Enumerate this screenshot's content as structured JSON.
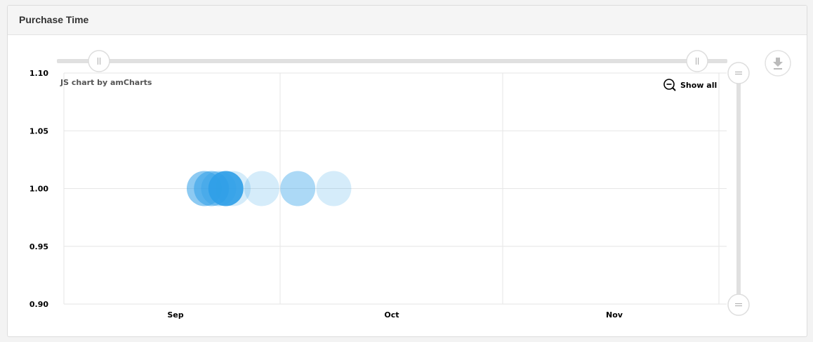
{
  "panel": {
    "title": "Purchase Time"
  },
  "chart_data": {
    "type": "scatter",
    "title": "",
    "xlabel": "",
    "ylabel": "",
    "x_ticks": [
      "Sep",
      "Oct",
      "Nov"
    ],
    "y_ticks": [
      "1.10",
      "1.05",
      "1.00",
      "0.95",
      "0.90"
    ],
    "ylim": [
      0.9,
      1.1
    ],
    "xlim": [
      "2017-08-25",
      "2017-11-30"
    ],
    "grid": true,
    "legend": "none",
    "series": [
      {
        "points": [
          {
            "x": "2017-09-05",
            "y": 1.0,
            "opacity": 0.55
          },
          {
            "x": "2017-09-06",
            "y": 1.0,
            "opacity": 0.55
          },
          {
            "x": "2017-09-07",
            "y": 1.0,
            "opacity": 0.35
          },
          {
            "x": "2017-09-08",
            "y": 1.0,
            "opacity": 0.9
          },
          {
            "x": "2017-09-09",
            "y": 1.0,
            "opacity": 0.2
          },
          {
            "x": "2017-09-13",
            "y": 1.0,
            "opacity": 0.2
          },
          {
            "x": "2017-09-18",
            "y": 1.0,
            "opacity": 0.4
          },
          {
            "x": "2017-09-23",
            "y": 1.0,
            "opacity": 0.2
          }
        ]
      }
    ],
    "bubble_color": "#2f9fe8",
    "credit": "JS chart by amCharts",
    "show_all": "Show all"
  }
}
